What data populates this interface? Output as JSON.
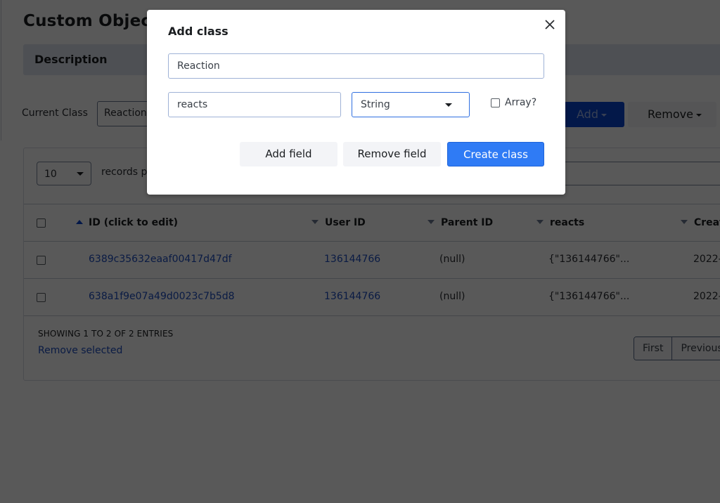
{
  "page": {
    "title": "Custom Objects",
    "description_label": "Description",
    "current_class_label": "Current Class",
    "current_class_value": "Reaction",
    "add_button": "Add",
    "remove_button": "Remove"
  },
  "table": {
    "per_page_value": "10",
    "per_page_label": "records pe",
    "columns": [
      {
        "label": "ID (click to edit)",
        "sort": "asc"
      },
      {
        "label": "User ID",
        "sort": "desc"
      },
      {
        "label": "Parent ID",
        "sort": "desc"
      },
      {
        "label": "reacts",
        "sort": "desc"
      },
      {
        "label": "Creat",
        "sort": "desc"
      }
    ],
    "rows": [
      {
        "id": "6389c35632eaaf00417d47df",
        "user_id": "136144766",
        "parent_id": "(null)",
        "reacts": "{\"136144766\"...",
        "created": "2022-"
      },
      {
        "id": "638a1f9e07a49d0023c7b5d8",
        "user_id": "136144766",
        "parent_id": "(null)",
        "reacts": "{\"136144766\"...",
        "created": "2022-"
      }
    ],
    "showing_text": "SHOWING 1 TO 2 OF 2 ENTRIES",
    "remove_selected": "Remove selected",
    "pager": [
      "First",
      "Previous"
    ]
  },
  "modal": {
    "title": "Add class",
    "close_icon": "close-icon",
    "class_name_value": "Reaction",
    "field_name_value": "reacts",
    "field_type_value": "String",
    "array_label": "Array?",
    "array_checked": false,
    "add_field_label": "Add field",
    "remove_field_label": "Remove field",
    "create_class_label": "Create class"
  },
  "colors": {
    "primary": "#2f7bf5",
    "link": "#1f4fc2",
    "backdrop": "#595959"
  }
}
